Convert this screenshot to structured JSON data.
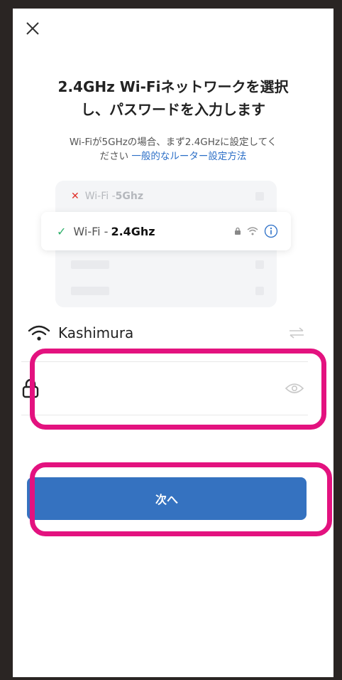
{
  "header": {
    "close_icon": "close-icon"
  },
  "title_lines": [
    "2.4GHz Wi-Fiネットワークを選択",
    "し、パスワードを入力します"
  ],
  "subtitle": {
    "line1": "Wi-Fiが5GHzの場合、まず2.4GHzに設定してく",
    "line2": "ださい",
    "link": "一般的なルーター設定方法"
  },
  "illustration": {
    "bad_row": {
      "prefix": "Wi-Fi - ",
      "band": "5Ghz"
    },
    "good_row": {
      "prefix": "Wi-Fi - ",
      "band": "2.4Ghz"
    }
  },
  "network": {
    "ssid": "Kashimura"
  },
  "password": {
    "value": "",
    "placeholder": ""
  },
  "next_button": {
    "label": "次へ"
  },
  "colors": {
    "accent": "#3572c0",
    "highlight": "#e3127f",
    "link": "#2c6fc7",
    "ok": "#2db06a",
    "error": "#e0302a"
  }
}
